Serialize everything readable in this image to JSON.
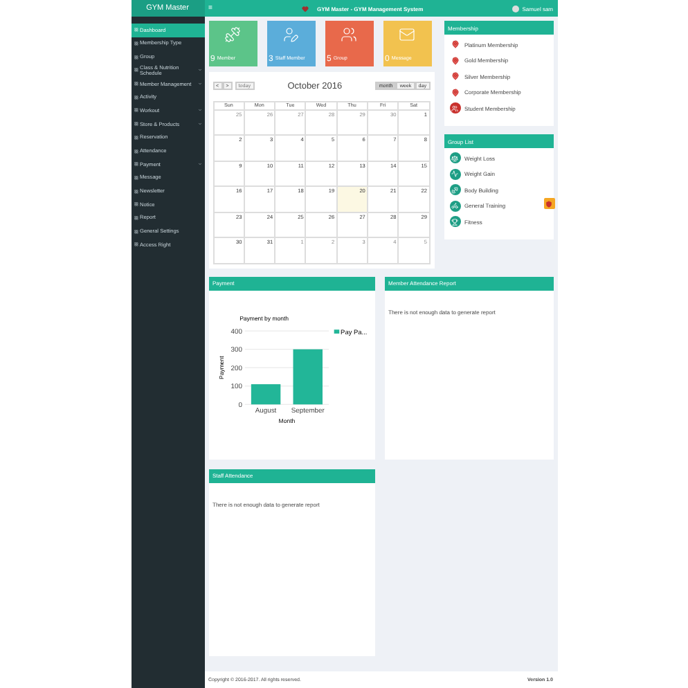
{
  "brand": "GYM Master",
  "topbar": {
    "menu": "≡",
    "title": "GYM Master - GYM Management System",
    "user": "Samuel sam"
  },
  "sidebar": {
    "items": [
      {
        "label": "Dashboard",
        "selected": true,
        "arrow": false
      },
      {
        "label": "Membership Type",
        "selected": false,
        "arrow": false
      },
      {
        "label": "Group",
        "selected": false,
        "arrow": false
      },
      {
        "label": "Class & Nutrition Schedule",
        "selected": false,
        "arrow": true
      },
      {
        "label": "Member Management",
        "selected": false,
        "arrow": true
      },
      {
        "label": "Activity",
        "selected": false,
        "arrow": false
      },
      {
        "label": "Workout",
        "selected": false,
        "arrow": true
      },
      {
        "label": "Store & Products",
        "selected": false,
        "arrow": true
      },
      {
        "label": "Reservation",
        "selected": false,
        "arrow": false
      },
      {
        "label": "Attendance",
        "selected": false,
        "arrow": false
      },
      {
        "label": "Payment",
        "selected": false,
        "arrow": true
      },
      {
        "label": "Message",
        "selected": false,
        "arrow": false
      },
      {
        "label": "Newsletter",
        "selected": false,
        "arrow": false
      },
      {
        "label": "Notice",
        "selected": false,
        "arrow": false
      },
      {
        "label": "Report",
        "selected": false,
        "arrow": false
      },
      {
        "label": "General Settings",
        "selected": false,
        "arrow": false
      },
      {
        "label": "Access Right",
        "selected": false,
        "arrow": false
      }
    ]
  },
  "tiles": [
    {
      "kind": "member",
      "count": "9",
      "label": "Member",
      "color": "#5cc489"
    },
    {
      "kind": "staff",
      "count": "3",
      "label": "Staff Member",
      "color": "#5badda"
    },
    {
      "kind": "group",
      "count": "5",
      "label": "Group",
      "color": "#e8694b"
    },
    {
      "kind": "message",
      "count": "0",
      "label": "Message",
      "color": "#f2c24f"
    }
  ],
  "calendar": {
    "title": "October 2016",
    "prev": "<",
    "next": ">",
    "today_button": "today",
    "views": [
      {
        "label": "month",
        "selected": true
      },
      {
        "label": "week",
        "selected": false
      },
      {
        "label": "day",
        "selected": false
      }
    ],
    "weekdays": [
      "Sun",
      "Mon",
      "Tue",
      "Wed",
      "Thu",
      "Fri",
      "Sat"
    ],
    "weeks": [
      [
        {
          "day": "25",
          "other_month": true,
          "today": false
        },
        {
          "day": "26",
          "other_month": true,
          "today": false
        },
        {
          "day": "27",
          "other_month": true,
          "today": false
        },
        {
          "day": "28",
          "other_month": true,
          "today": false
        },
        {
          "day": "29",
          "other_month": true,
          "today": false
        },
        {
          "day": "30",
          "other_month": true,
          "today": false
        },
        {
          "day": "1",
          "other_month": false,
          "today": false
        }
      ],
      [
        {
          "day": "2",
          "other_month": false,
          "today": false
        },
        {
          "day": "3",
          "other_month": false,
          "today": false
        },
        {
          "day": "4",
          "other_month": false,
          "today": false
        },
        {
          "day": "5",
          "other_month": false,
          "today": false
        },
        {
          "day": "6",
          "other_month": false,
          "today": false
        },
        {
          "day": "7",
          "other_month": false,
          "today": false
        },
        {
          "day": "8",
          "other_month": false,
          "today": false
        }
      ],
      [
        {
          "day": "9",
          "other_month": false,
          "today": false
        },
        {
          "day": "10",
          "other_month": false,
          "today": false
        },
        {
          "day": "11",
          "other_month": false,
          "today": false
        },
        {
          "day": "12",
          "other_month": false,
          "today": false
        },
        {
          "day": "13",
          "other_month": false,
          "today": false
        },
        {
          "day": "14",
          "other_month": false,
          "today": false
        },
        {
          "day": "15",
          "other_month": false,
          "today": false
        }
      ],
      [
        {
          "day": "16",
          "other_month": false,
          "today": false
        },
        {
          "day": "17",
          "other_month": false,
          "today": false
        },
        {
          "day": "18",
          "other_month": false,
          "today": false
        },
        {
          "day": "19",
          "other_month": false,
          "today": false
        },
        {
          "day": "20",
          "other_month": false,
          "today": true
        },
        {
          "day": "21",
          "other_month": false,
          "today": false
        },
        {
          "day": "22",
          "other_month": false,
          "today": false
        }
      ],
      [
        {
          "day": "23",
          "other_month": false,
          "today": false
        },
        {
          "day": "24",
          "other_month": false,
          "today": false
        },
        {
          "day": "25",
          "other_month": false,
          "today": false
        },
        {
          "day": "26",
          "other_month": false,
          "today": false
        },
        {
          "day": "27",
          "other_month": false,
          "today": false
        },
        {
          "day": "28",
          "other_month": false,
          "today": false
        },
        {
          "day": "29",
          "other_month": false,
          "today": false
        }
      ],
      [
        {
          "day": "30",
          "other_month": false,
          "today": false
        },
        {
          "day": "31",
          "other_month": false,
          "today": false
        },
        {
          "day": "1",
          "other_month": true,
          "today": false
        },
        {
          "day": "2",
          "other_month": true,
          "today": false
        },
        {
          "day": "3",
          "other_month": true,
          "today": false
        },
        {
          "day": "4",
          "other_month": true,
          "today": false
        },
        {
          "day": "5",
          "other_month": true,
          "today": false
        }
      ]
    ]
  },
  "membership": {
    "title": "Membership",
    "items": [
      {
        "label": "Platinum Membership",
        "kind": "pin"
      },
      {
        "label": "Gold Membership",
        "kind": "pin"
      },
      {
        "label": "Silver Membership",
        "kind": "pin"
      },
      {
        "label": "Corporate Membership",
        "kind": "pin"
      },
      {
        "label": "Student Membership",
        "kind": "badge"
      }
    ]
  },
  "groups": {
    "title": "Group List",
    "items": [
      {
        "label": "Weight Loss",
        "kind": "loss"
      },
      {
        "label": "Weight Gain",
        "kind": "gain"
      },
      {
        "label": "Body Building",
        "kind": "building"
      },
      {
        "label": "General Training",
        "kind": "training"
      },
      {
        "label": "Fitness",
        "kind": "fitness"
      }
    ]
  },
  "payment": {
    "title": "Payment",
    "chart_data": {
      "type": "bar",
      "grid": true,
      "title": "Payment by month",
      "xlabel": "Month",
      "ylabel": "Payment",
      "categories": [
        "August",
        "September"
      ],
      "series": [
        {
          "name": "Pay Pa...",
          "color": "#22b698",
          "values": [
            110,
            300
          ]
        }
      ],
      "ylim": [
        0,
        400
      ],
      "yticks": [
        0,
        100,
        200,
        300,
        400
      ]
    }
  },
  "member_attendance": {
    "title": "Member Attendance Report",
    "message": "There is not enough data to generate report"
  },
  "staff_attendance": {
    "title": "Staff Attendance",
    "message": "There is not enough data to generate report"
  },
  "footer": {
    "copyright": "Copyright © 2016-2017. All rights reserved.",
    "version": "Version 1.0"
  }
}
